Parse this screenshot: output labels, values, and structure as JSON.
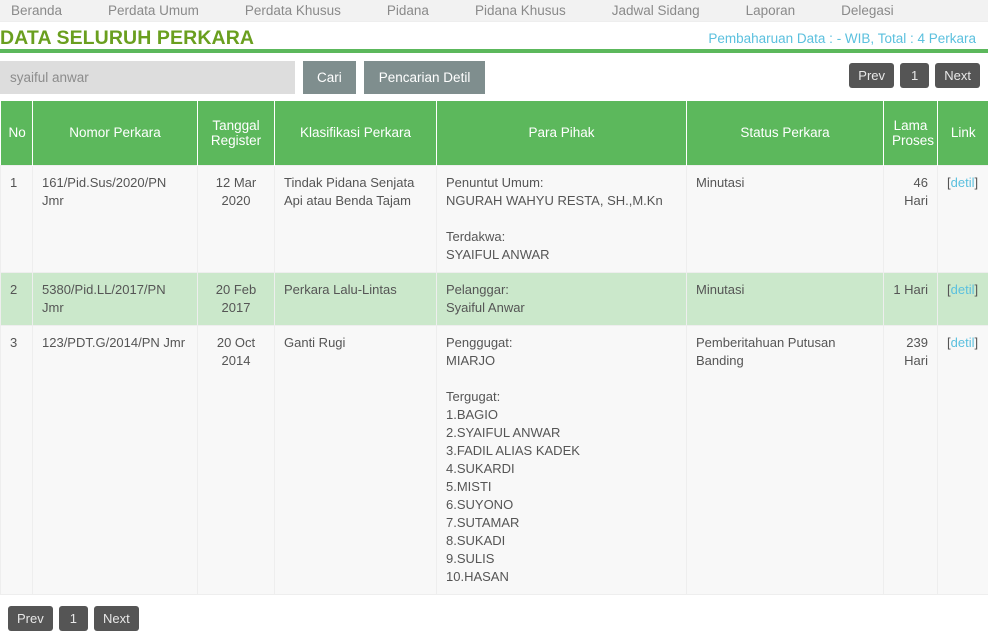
{
  "nav": {
    "items": [
      {
        "label": "Beranda",
        "name": "nav-beranda"
      },
      {
        "label": "Perdata Umum",
        "name": "nav-perdata-umum"
      },
      {
        "label": "Perdata Khusus",
        "name": "nav-perdata-khusus"
      },
      {
        "label": "Pidana",
        "name": "nav-pidana"
      },
      {
        "label": "Pidana Khusus",
        "name": "nav-pidana-khusus"
      },
      {
        "label": "Jadwal Sidang",
        "name": "nav-jadwal-sidang"
      },
      {
        "label": "Laporan",
        "name": "nav-laporan"
      },
      {
        "label": "Delegasi",
        "name": "nav-delegasi"
      }
    ]
  },
  "header": {
    "title": "DATA SELURUH PERKARA",
    "update_link": "Pembaharuan Data : - WIB, Total : 4 Perkara",
    "title_color": "#6a9f1f",
    "link_color": "#5bc0de",
    "rule_color": "#5cb85c"
  },
  "search": {
    "value": "syaiful anwar",
    "placeholder": "syaiful anwar",
    "cari_label": "Cari",
    "detail_label": "Pencarian Detil"
  },
  "pagination": {
    "prev_label": "Prev",
    "page_label": "1",
    "next_label": "Next"
  },
  "table": {
    "headers": {
      "no": "No",
      "nomor_perkara": "Nomor Perkara",
      "tanggal_register": "Tanggal Register",
      "klasifikasi": "Klasifikasi Perkara",
      "para_pihak": "Para Pihak",
      "status": "Status Perkara",
      "lama_proses": "Lama Proses",
      "link": "Link"
    },
    "rows": [
      {
        "no": "1",
        "nomor_perkara": "161/Pid.Sus/2020/PN Jmr",
        "tanggal_register": "12 Mar 2020",
        "klasifikasi": "Tindak Pidana Senjata Api atau Benda Tajam",
        "pihak_role1": "Penuntut Umum:",
        "pihak_name1": "NGURAH WAHYU RESTA, SH.,M.Kn",
        "pihak_role2": "Terdakwa:",
        "pihak_name2": "SYAIFUL ANWAR",
        "status": "Minutasi",
        "lama_proses": "46 Hari",
        "link_text": "detil",
        "highlight": false
      },
      {
        "no": "2",
        "nomor_perkara": "5380/Pid.LL/2017/PN Jmr",
        "tanggal_register": "20 Feb 2017",
        "klasifikasi": "Perkara Lalu-Lintas",
        "pihak_role1": "Pelanggar:",
        "pihak_name1": "Syaiful Anwar",
        "pihak_role2": "",
        "pihak_name2": "",
        "status": "Minutasi",
        "lama_proses": "1 Hari",
        "link_text": "detil",
        "highlight": true
      },
      {
        "no": "3",
        "nomor_perkara": "123/PDT.G/2014/PN Jmr",
        "tanggal_register": "20 Oct 2014",
        "klasifikasi": "Ganti Rugi",
        "pihak_role1": "Penggugat:",
        "pihak_name1": "MIARJO",
        "pihak_role2": "Tergugat:",
        "pihak_name2": "1.BAGIO\n2.SYAIFUL ANWAR\n3.FADIL ALIAS KADEK\n4.SUKARDI\n5.MISTI\n6.SUYONO\n7.SUTAMAR\n8.SUKADI\n9.SULIS\n10.HASAN",
        "status": "Pemberitahuan Putusan Banding",
        "lama_proses": "239 Hari",
        "link_text": "detil",
        "highlight": false
      }
    ]
  }
}
